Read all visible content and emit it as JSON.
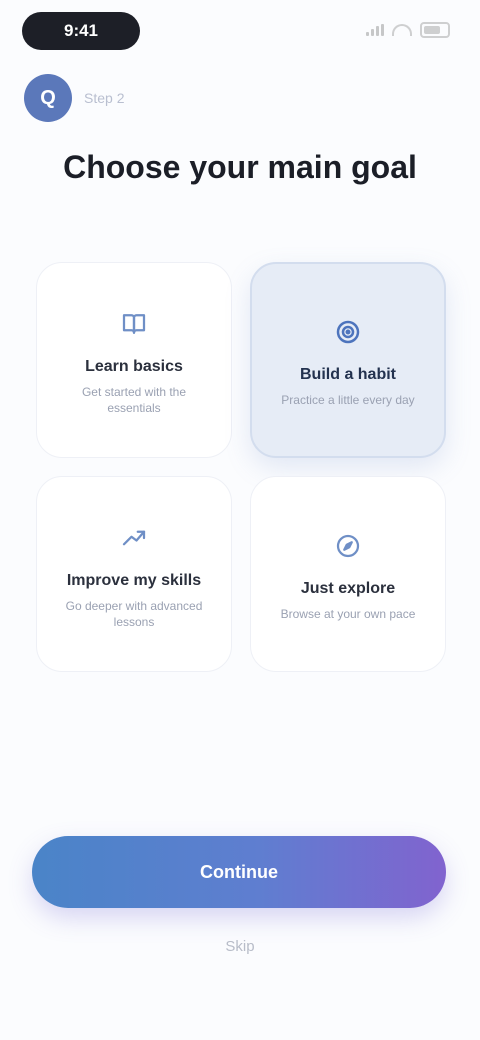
{
  "status_bar": {
    "time": "9:41"
  },
  "header": {
    "avatar_initial": "Q",
    "label": "Step 2"
  },
  "title": "Choose your main goal",
  "options": [
    {
      "title": "Learn basics",
      "desc": "Get started with the essentials",
      "icon": "book-icon",
      "selected": false
    },
    {
      "title": "Build a habit",
      "desc": "Practice a little every day",
      "icon": "target-icon",
      "selected": true
    },
    {
      "title": "Improve my skills",
      "desc": "Go deeper with advanced lessons",
      "icon": "trend-icon",
      "selected": false
    },
    {
      "title": "Just explore",
      "desc": "Browse at your own pace",
      "icon": "compass-icon",
      "selected": false
    }
  ],
  "continue_label": "Continue",
  "skip_label": "Skip",
  "colors": {
    "accent_start": "#4a84c8",
    "accent_end": "#8163cf",
    "selected_card": "#e6ecf6"
  }
}
